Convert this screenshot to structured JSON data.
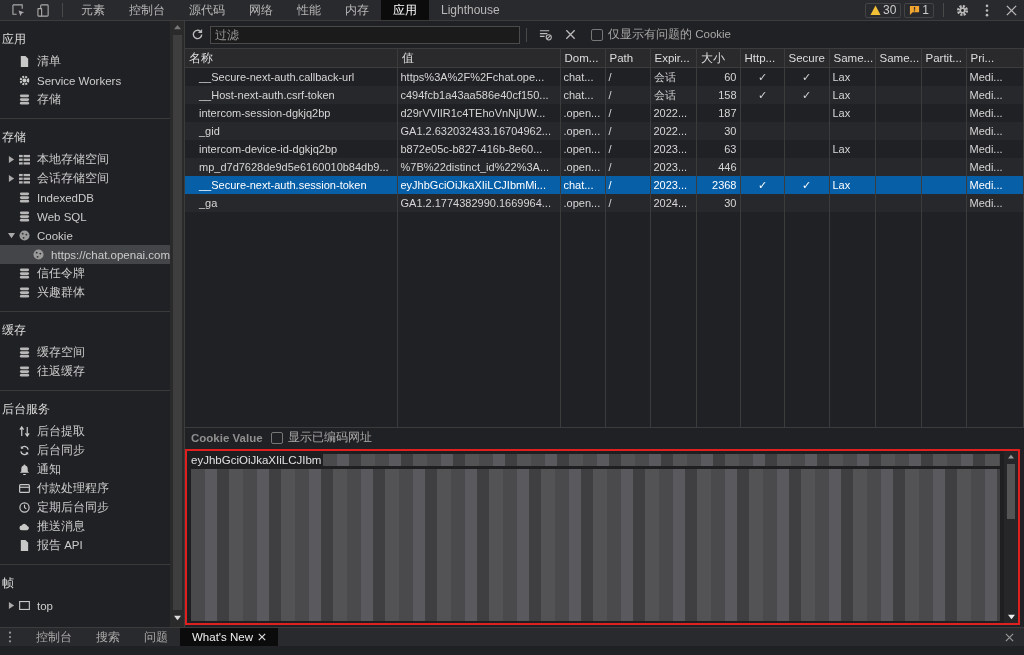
{
  "toolbar": {
    "tabs": [
      {
        "label": "元素",
        "selected": false
      },
      {
        "label": "控制台",
        "selected": false
      },
      {
        "label": "源代码",
        "selected": false
      },
      {
        "label": "网络",
        "selected": false
      },
      {
        "label": "性能",
        "selected": false
      },
      {
        "label": "内存",
        "selected": false
      },
      {
        "label": "应用",
        "selected": true
      },
      {
        "label": "Lighthouse",
        "selected": false
      }
    ],
    "warnings": "30",
    "issues": "1"
  },
  "sidebar": {
    "sections": [
      {
        "title": "应用",
        "items": [
          {
            "label": "清单",
            "kind": "file",
            "selected": false
          },
          {
            "label": "Service Workers",
            "kind": "gear",
            "selected": false
          },
          {
            "label": "存储",
            "kind": "database",
            "selected": false
          }
        ]
      },
      {
        "title": "存储",
        "items": [
          {
            "label": "本地存储空间",
            "kind": "grid",
            "expanded": false,
            "selected": false
          },
          {
            "label": "会话存储空间",
            "kind": "grid",
            "expanded": false,
            "selected": false
          },
          {
            "label": "IndexedDB",
            "kind": "database",
            "selected": false
          },
          {
            "label": "Web SQL",
            "kind": "database",
            "selected": false
          },
          {
            "label": "Cookie",
            "kind": "cookie",
            "expanded": true,
            "selected": false,
            "children": [
              {
                "label": "https://chat.openai.com",
                "kind": "cookie",
                "selected": true
              }
            ]
          },
          {
            "label": "信任令牌",
            "kind": "database",
            "selected": false
          },
          {
            "label": "兴趣群体",
            "kind": "database",
            "selected": false
          }
        ]
      },
      {
        "title": "缓存",
        "items": [
          {
            "label": "缓存空间",
            "kind": "database",
            "selected": false
          },
          {
            "label": "往返缓存",
            "kind": "database",
            "selected": false
          }
        ]
      },
      {
        "title": "后台服务",
        "items": [
          {
            "label": "后台提取",
            "kind": "arrows",
            "selected": false
          },
          {
            "label": "后台同步",
            "kind": "sync",
            "selected": false
          },
          {
            "label": "通知",
            "kind": "bell",
            "selected": false
          },
          {
            "label": "付款处理程序",
            "kind": "card",
            "selected": false
          },
          {
            "label": "定期后台同步",
            "kind": "clock",
            "selected": false
          },
          {
            "label": "推送消息",
            "kind": "cloud",
            "selected": false
          },
          {
            "label": "报告 API",
            "kind": "file",
            "selected": false
          }
        ]
      },
      {
        "title": "帧",
        "items": [
          {
            "label": "top",
            "kind": "frame",
            "expanded": false,
            "selected": false
          }
        ]
      }
    ]
  },
  "filter": {
    "placeholder": "过滤",
    "only_issues": {
      "label": "仅显示有问题的 Cookie",
      "checked": false
    }
  },
  "table": {
    "columns": [
      "名称",
      "值",
      "Dom...",
      "Path",
      "Expir...",
      "大小",
      "Http...",
      "Secure",
      "Same...",
      "Same...",
      "Partit...",
      "Pri..."
    ],
    "rows": [
      {
        "selected": false,
        "cells": [
          "__Secure-next-auth.callback-url",
          "https%3A%2F%2Fchat.ope...",
          "chat...",
          "/",
          "会话",
          "60",
          "✓",
          "✓",
          "Lax",
          "",
          "",
          "Medi..."
        ]
      },
      {
        "selected": false,
        "cells": [
          "__Host-next-auth.csrf-token",
          "c494fcb1a43aa586e40cf150...",
          "chat...",
          "/",
          "会话",
          "158",
          "✓",
          "✓",
          "Lax",
          "",
          "",
          "Medi..."
        ]
      },
      {
        "selected": false,
        "cells": [
          "intercom-session-dgkjq2bp",
          "d29rVVlIR1c4TEhoVnNjUW...",
          ".open...",
          "/",
          "2022...",
          "187",
          "",
          "",
          "Lax",
          "",
          "",
          "Medi..."
        ]
      },
      {
        "selected": false,
        "cells": [
          "_gid",
          "GA1.2.632032433.16704962...",
          ".open...",
          "/",
          "2022...",
          "30",
          "",
          "",
          "",
          "",
          "",
          "Medi..."
        ]
      },
      {
        "selected": false,
        "cells": [
          "intercom-device-id-dgkjq2bp",
          "b872e05c-b827-416b-8e60...",
          ".open...",
          "/",
          "2023...",
          "63",
          "",
          "",
          "Lax",
          "",
          "",
          "Medi..."
        ]
      },
      {
        "selected": false,
        "cells": [
          "mp_d7d7628de9d5e6160010b84db9...",
          "%7B%22distinct_id%22%3A...",
          ".open...",
          "/",
          "2023...",
          "446",
          "",
          "",
          "",
          "",
          "",
          "Medi..."
        ]
      },
      {
        "selected": true,
        "cells": [
          "__Secure-next-auth.session-token",
          "eyJhbGciOiJkaXIiLCJIbmMi...",
          "chat...",
          "/",
          "2023...",
          "2368",
          "✓",
          "✓",
          "Lax",
          "",
          "",
          "Medi..."
        ]
      },
      {
        "selected": false,
        "cells": [
          "_ga",
          "GA1.2.1774382990.1669964...",
          ".open...",
          "/",
          "2024...",
          "30",
          "",
          "",
          "",
          "",
          "",
          "Medi..."
        ]
      }
    ]
  },
  "cookie_value": {
    "title": "Cookie Value",
    "show_decoded": {
      "label": "显示已编码网址",
      "checked": false
    },
    "value": "eyJhbGciOiJkaXIiLCJIbm",
    "highlighted": true
  },
  "drawer": {
    "tabs": [
      {
        "label": "控制台",
        "selected": false,
        "closable": false
      },
      {
        "label": "搜索",
        "selected": false,
        "closable": false
      },
      {
        "label": "问题",
        "selected": false,
        "closable": false
      },
      {
        "label": "What's New",
        "selected": true,
        "closable": true
      }
    ]
  }
}
